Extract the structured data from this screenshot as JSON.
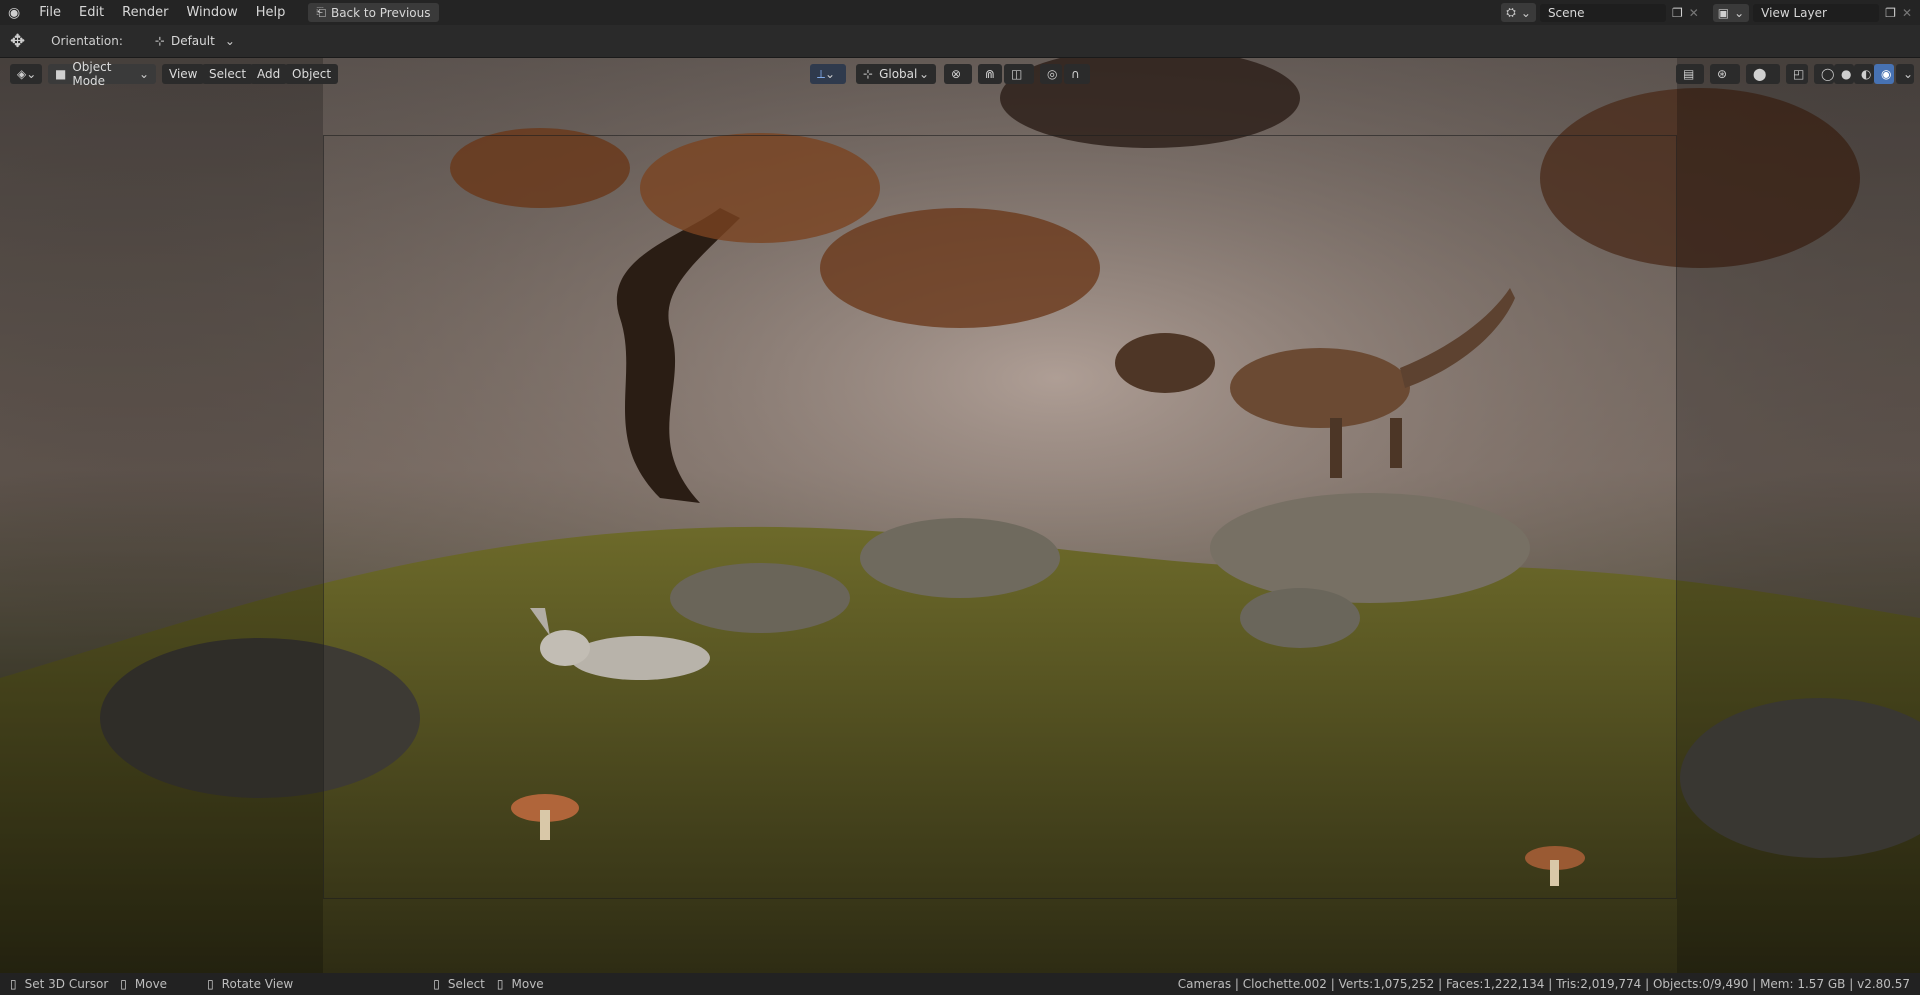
{
  "topbar": {
    "menus": [
      "File",
      "Edit",
      "Render",
      "Window",
      "Help"
    ],
    "back_button": "Back to Previous",
    "scene_value": "Scene",
    "view_layer_value": "View Layer"
  },
  "toolbar": {
    "orientation_label": "Orientation:",
    "orientation_value": "Default"
  },
  "viewport_header": {
    "mode": "Object Mode",
    "menus": [
      "View",
      "Select",
      "Add",
      "Object"
    ],
    "transform_orientation": "Global"
  },
  "statusbar": {
    "hints": [
      {
        "icon": "mouse-left-icon",
        "label": "Set 3D Cursor"
      },
      {
        "icon": "mouse-right-icon",
        "label": "Move"
      },
      {
        "icon": "mouse-middle-icon",
        "label": "Rotate View"
      },
      {
        "icon": "mouse-left-icon",
        "label": "Select"
      },
      {
        "icon": "mouse-right-icon",
        "label": "Move"
      }
    ],
    "info": "Cameras | Clochette.002 | Verts:1,075,252 | Faces:1,222,134 | Tris:2,019,774 | Objects:0/9,490 | Mem: 1.57 GB | v2.80.57"
  },
  "colors": {
    "header": "#242424",
    "button": "#3a3a3a",
    "accent": "#4772b3"
  }
}
